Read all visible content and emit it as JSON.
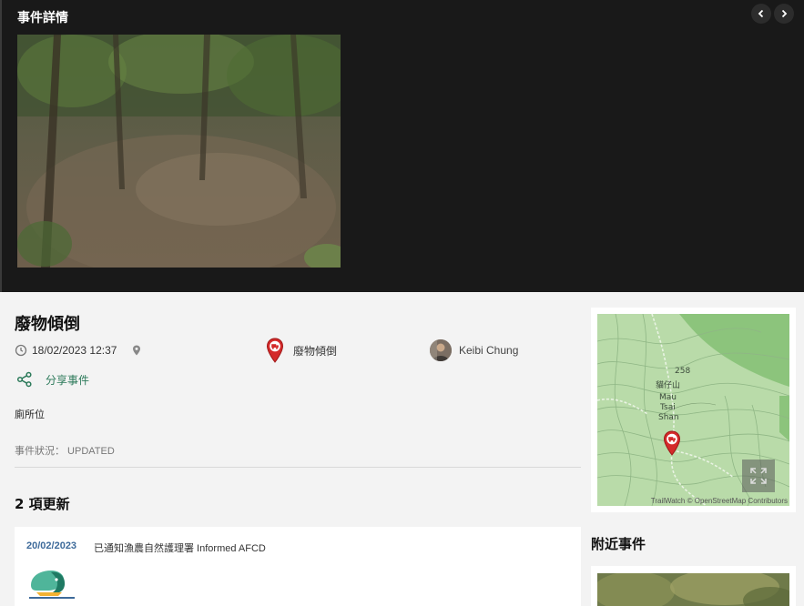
{
  "gallery": {
    "title": "事件詳情",
    "prev_icon": "chevron-left-icon",
    "next_icon": "chevron-right-icon"
  },
  "event": {
    "title": "廢物傾倒",
    "datetime": "18/02/2023 12:37",
    "category": "廢物傾倒",
    "reporter": "Keibi Chung",
    "share_label": "分享事件",
    "location_label": "廁所位",
    "status_label": "事件狀況：",
    "status_value": "UPDATED",
    "status_line": "事件狀況： UPDATED"
  },
  "updates": {
    "heading": "2 項更新",
    "items": [
      {
        "date": "20/02/2023",
        "text": "已通知漁農自然護理署 Informed AFCD"
      }
    ]
  },
  "map": {
    "elevation": "258",
    "place_zh": "貓仔山",
    "place_en_1": "Mau",
    "place_en_2": "Tsai",
    "place_en_3": "Shan",
    "attribution": "TrailWatch © OpenStreetMap Contributors"
  },
  "nearby": {
    "heading": "附近事件"
  },
  "colors": {
    "accent_green": "#2c7a5a",
    "marker_red": "#d42a2a",
    "update_date_blue": "#3d6a9a"
  }
}
